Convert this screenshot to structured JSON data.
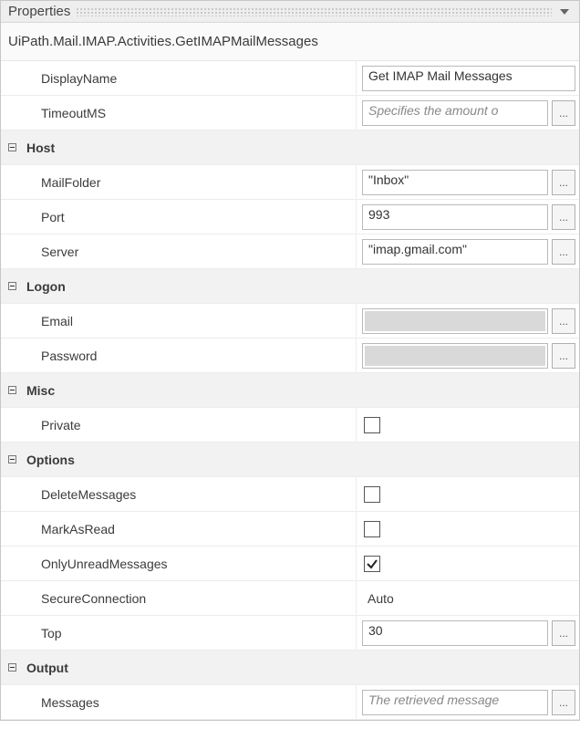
{
  "panel": {
    "title": "Properties"
  },
  "activity": {
    "fullName": "UiPath.Mail.IMAP.Activities.GetIMAPMailMessages"
  },
  "rows": {
    "displayName": {
      "label": "DisplayName",
      "value": "Get IMAP Mail Messages"
    },
    "timeoutMs": {
      "label": "TimeoutMS",
      "value": "",
      "placeholder": "Specifies the amount o"
    }
  },
  "sections": {
    "host": {
      "title": "Host",
      "mailFolder": {
        "label": "MailFolder",
        "value": "\"Inbox\""
      },
      "port": {
        "label": "Port",
        "value": "993"
      },
      "server": {
        "label": "Server",
        "value": "\"imap.gmail.com\""
      }
    },
    "logon": {
      "title": "Logon",
      "email": {
        "label": "Email",
        "value": ""
      },
      "password": {
        "label": "Password",
        "value": ""
      }
    },
    "misc": {
      "title": "Misc",
      "private": {
        "label": "Private",
        "checked": false
      }
    },
    "options": {
      "title": "Options",
      "deleteMessages": {
        "label": "DeleteMessages",
        "checked": false
      },
      "markAsRead": {
        "label": "MarkAsRead",
        "checked": false
      },
      "onlyUnreadMessages": {
        "label": "OnlyUnreadMessages",
        "checked": true
      },
      "secureConnection": {
        "label": "SecureConnection",
        "value": "Auto"
      },
      "top": {
        "label": "Top",
        "value": "30"
      }
    },
    "output": {
      "title": "Output",
      "messages": {
        "label": "Messages",
        "value": "",
        "placeholder": "The retrieved message"
      }
    }
  },
  "common": {
    "ellipsis": "..."
  }
}
